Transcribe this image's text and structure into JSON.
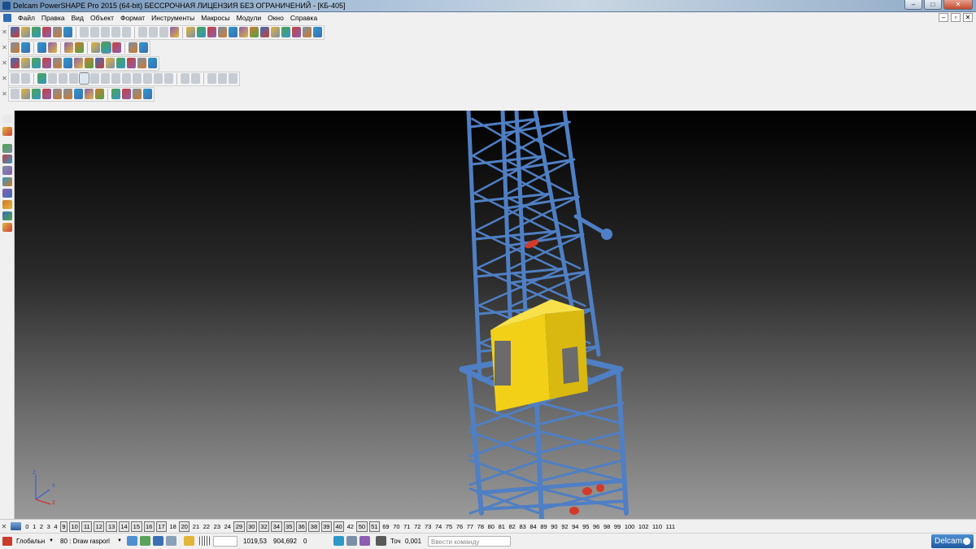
{
  "window": {
    "title": "Delcam PowerSHAPE Pro 2015 (64-bit) БЕССРОЧНАЯ ЛИЦЕНЗИЯ БЕЗ ОГРАНИЧЕНИЙ - [КБ-405]",
    "controls": [
      "–",
      "□",
      "✕"
    ]
  },
  "menu": {
    "items": [
      "Файл",
      "Правка",
      "Вид",
      "Объект",
      "Формат",
      "Инструменты",
      "Макросы",
      "Модули",
      "Окно",
      "Справка"
    ],
    "mdi_controls": [
      "–",
      "▫",
      "✕"
    ]
  },
  "toolbars": {
    "colors": [
      "#3a6fb5",
      "#e2b53a",
      "#4da34d",
      "#c9403a",
      "#7c8fa6",
      "#2f98c9",
      "#8a5fb0",
      "#d07a2a"
    ],
    "disabled_color": "#c7ccd3"
  },
  "viewport": {
    "background": "gradient-black-to-grey",
    "model_color": "#4f7fc4",
    "cabin_color": "#f2d017",
    "axes": {
      "x": "x",
      "y": "y",
      "z": "z"
    }
  },
  "levels": {
    "icon": "level-icon",
    "items": [
      {
        "n": "0"
      },
      {
        "n": "1"
      },
      {
        "n": "2"
      },
      {
        "n": "3"
      },
      {
        "n": "4"
      },
      {
        "n": "9",
        "on": true
      },
      {
        "n": "10",
        "on": true
      },
      {
        "n": "11",
        "on": true
      },
      {
        "n": "12",
        "on": true
      },
      {
        "n": "13",
        "on": true
      },
      {
        "n": "14",
        "on": true
      },
      {
        "n": "15",
        "on": true
      },
      {
        "n": "16",
        "on": true
      },
      {
        "n": "17",
        "on": true
      },
      {
        "n": "18"
      },
      {
        "n": "20",
        "on": true
      },
      {
        "n": "21"
      },
      {
        "n": "22"
      },
      {
        "n": "23"
      },
      {
        "n": "24"
      },
      {
        "n": "29",
        "on": true
      },
      {
        "n": "30",
        "on": true
      },
      {
        "n": "32",
        "on": true
      },
      {
        "n": "34",
        "on": true
      },
      {
        "n": "35",
        "on": true
      },
      {
        "n": "36",
        "on": true
      },
      {
        "n": "38",
        "on": true
      },
      {
        "n": "39",
        "on": true
      },
      {
        "n": "40",
        "on": true
      },
      {
        "n": "42"
      },
      {
        "n": "50",
        "on": true
      },
      {
        "n": "51",
        "on": true
      },
      {
        "n": "69"
      },
      {
        "n": "70"
      },
      {
        "n": "71"
      },
      {
        "n": "72"
      },
      {
        "n": "73"
      },
      {
        "n": "74"
      },
      {
        "n": "75"
      },
      {
        "n": "76"
      },
      {
        "n": "77"
      },
      {
        "n": "78"
      },
      {
        "n": "80"
      },
      {
        "n": "81"
      },
      {
        "n": "82"
      },
      {
        "n": "83"
      },
      {
        "n": "84"
      },
      {
        "n": "89"
      },
      {
        "n": "90"
      },
      {
        "n": "92"
      },
      {
        "n": "94"
      },
      {
        "n": "95"
      },
      {
        "n": "96"
      },
      {
        "n": "98"
      },
      {
        "n": "99"
      },
      {
        "n": "100"
      },
      {
        "n": "102"
      },
      {
        "n": "110"
      },
      {
        "n": "111"
      }
    ]
  },
  "status": {
    "workplane": "Глобальн",
    "level": "80 : Draw rasporl",
    "x_coord": "1019,53",
    "y_coord": "904,692",
    "z_coord": "0",
    "tolerance_label": "Точ",
    "tolerance_value": "0,001",
    "command_placeholder": "Ввести команду",
    "brand": "Delcam"
  }
}
